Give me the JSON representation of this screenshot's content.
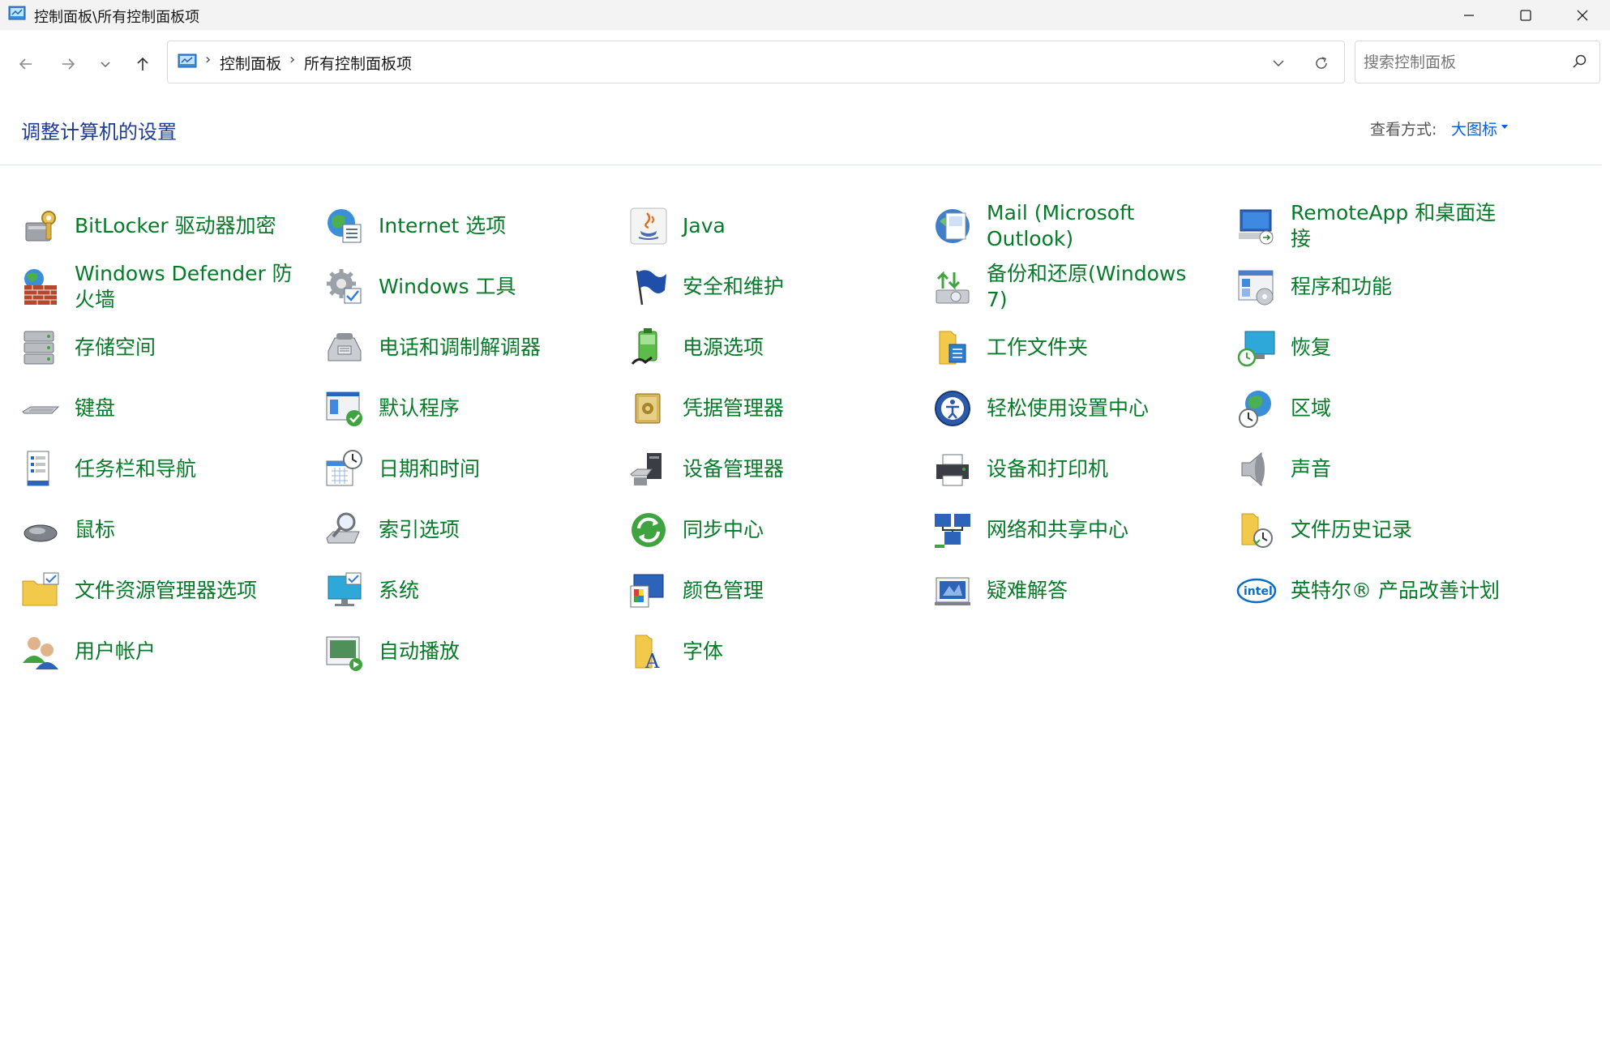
{
  "window": {
    "title": "控制面板\\所有控制面板项"
  },
  "address": {
    "crumbs": [
      "控制面板",
      "所有控制面板项"
    ]
  },
  "search": {
    "placeholder": "搜索控制面板"
  },
  "header": {
    "title": "调整计算机的设置",
    "view_by_label": "查看方式:",
    "view_by_value": "大图标"
  },
  "items": [
    {
      "label": "BitLocker 驱动器加密",
      "icon": "bitlocker-icon"
    },
    {
      "label": "Internet 选项",
      "icon": "internet-options-icon"
    },
    {
      "label": "Java",
      "icon": "java-icon"
    },
    {
      "label": "Mail (Microsoft Outlook)",
      "icon": "mail-icon"
    },
    {
      "label": "RemoteApp 和桌面连接",
      "icon": "remoteapp-icon"
    },
    {
      "label": "Windows Defender 防火墙",
      "icon": "firewall-icon"
    },
    {
      "label": "Windows 工具",
      "icon": "windows-tools-icon"
    },
    {
      "label": "安全和维护",
      "icon": "security-flag-icon"
    },
    {
      "label": "备份和还原(Windows 7)",
      "icon": "backup-icon"
    },
    {
      "label": "程序和功能",
      "icon": "programs-icon"
    },
    {
      "label": "存储空间",
      "icon": "storage-icon"
    },
    {
      "label": "电话和调制解调器",
      "icon": "phone-modem-icon"
    },
    {
      "label": "电源选项",
      "icon": "power-icon"
    },
    {
      "label": "工作文件夹",
      "icon": "work-folders-icon"
    },
    {
      "label": "恢复",
      "icon": "recovery-icon"
    },
    {
      "label": "键盘",
      "icon": "keyboard-icon"
    },
    {
      "label": "默认程序",
      "icon": "default-programs-icon"
    },
    {
      "label": "凭据管理器",
      "icon": "credential-icon"
    },
    {
      "label": "轻松使用设置中心",
      "icon": "ease-of-access-icon"
    },
    {
      "label": "区域",
      "icon": "region-icon"
    },
    {
      "label": "任务栏和导航",
      "icon": "taskbar-icon"
    },
    {
      "label": "日期和时间",
      "icon": "datetime-icon"
    },
    {
      "label": "设备管理器",
      "icon": "device-manager-icon"
    },
    {
      "label": "设备和打印机",
      "icon": "printer-icon"
    },
    {
      "label": "声音",
      "icon": "sound-icon"
    },
    {
      "label": "鼠标",
      "icon": "mouse-icon"
    },
    {
      "label": "索引选项",
      "icon": "indexing-icon"
    },
    {
      "label": "同步中心",
      "icon": "sync-icon"
    },
    {
      "label": "网络和共享中心",
      "icon": "network-icon"
    },
    {
      "label": "文件历史记录",
      "icon": "file-history-icon"
    },
    {
      "label": "文件资源管理器选项",
      "icon": "folder-options-icon"
    },
    {
      "label": "系统",
      "icon": "system-icon"
    },
    {
      "label": "颜色管理",
      "icon": "color-management-icon"
    },
    {
      "label": "疑难解答",
      "icon": "troubleshoot-icon"
    },
    {
      "label": "英特尔® 产品改善计划",
      "icon": "intel-icon"
    },
    {
      "label": "用户帐户",
      "icon": "user-accounts-icon"
    },
    {
      "label": "自动播放",
      "icon": "autoplay-icon"
    },
    {
      "label": "字体",
      "icon": "fonts-icon"
    }
  ],
  "colors": {
    "link_green": "#077a2a",
    "title_blue": "#1e3c8f",
    "accent_blue": "#0b5fd6"
  }
}
